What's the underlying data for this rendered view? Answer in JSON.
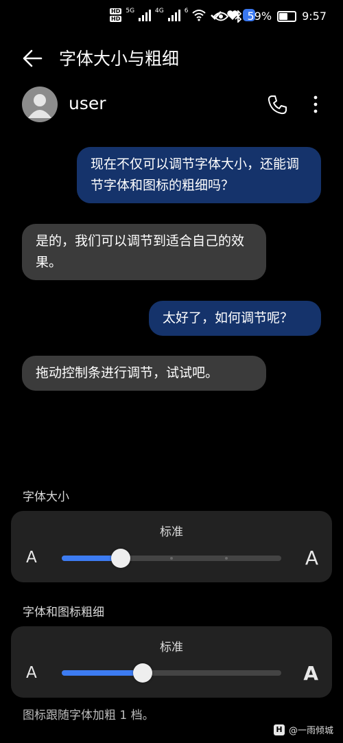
{
  "status_bar": {
    "hd1": "HD",
    "hd2": "HD",
    "net1": "5G",
    "net2": "4G",
    "net3": "6",
    "battery_percent": "59%",
    "battery_level": 0.59,
    "time": "9:57",
    "icons": [
      "hd-icon",
      "signal-icon",
      "wifi-icon",
      "heart-icon",
      "app-icon",
      "eye-icon",
      "bluetooth-icon",
      "battery-icon"
    ]
  },
  "app_bar": {
    "title": "字体大小与粗细"
  },
  "contact": {
    "name": "user"
  },
  "messages": [
    {
      "side": "out",
      "text": "现在不仅可以调节字体大小，还能调节字体和图标的粗细吗？"
    },
    {
      "side": "in",
      "text": "是的，我们可以调节到适合自己的效果。"
    },
    {
      "side": "out",
      "text": "太好了，如何调节呢？"
    },
    {
      "side": "in",
      "text": "拖动控制条进行调节，试试吧。"
    }
  ],
  "font_size": {
    "label": "字体大小",
    "value_label": "标准",
    "small_a": "A",
    "large_a": "A",
    "level_fraction": 0.27
  },
  "font_weight": {
    "label": "字体和图标粗细",
    "value_label": "标准",
    "small_a": "A",
    "large_a": "A",
    "level_fraction": 0.37
  },
  "footnote": "图标跟随字体加粗 1 档。",
  "watermark": {
    "icon": "H",
    "text": "@一雨倾城"
  },
  "colors": {
    "accent": "#3d7cf2",
    "outgoing_bubble": "#15336b",
    "incoming_bubble": "#3b3b3b",
    "card": "#222222"
  }
}
